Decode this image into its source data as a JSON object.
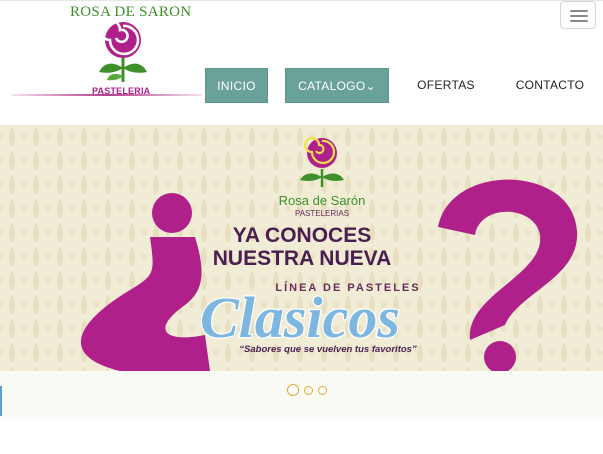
{
  "header": {
    "logo_title": "ROSA DE SARON",
    "logo_subtitle": "PASTELERIA"
  },
  "nav": {
    "inicio": "INICIO",
    "catalogo": "CATALOGO",
    "catalogo_caret": "⌄",
    "ofertas": "OFERTAS",
    "contacto": "CONTACTO"
  },
  "banner": {
    "brand": "Rosa de Sarón",
    "brand_sub": "PASTELERIAS",
    "line1": "YA CONOCES",
    "line2": "NUESTRA NUEVA",
    "line3": "LÍNEA DE PASTELES",
    "headline": "Clasicos",
    "tagline": "“Sabores que se vuelven tus favoritos”"
  },
  "carousel": {
    "indicator_count": 3,
    "active_index": 0
  },
  "colors": {
    "nav_button": "#6aa29a",
    "magenta": "#b0208a",
    "banner_bg": "#f1ecd6",
    "accent_green": "#3f8f2a",
    "indicator": "#e0a82e"
  }
}
